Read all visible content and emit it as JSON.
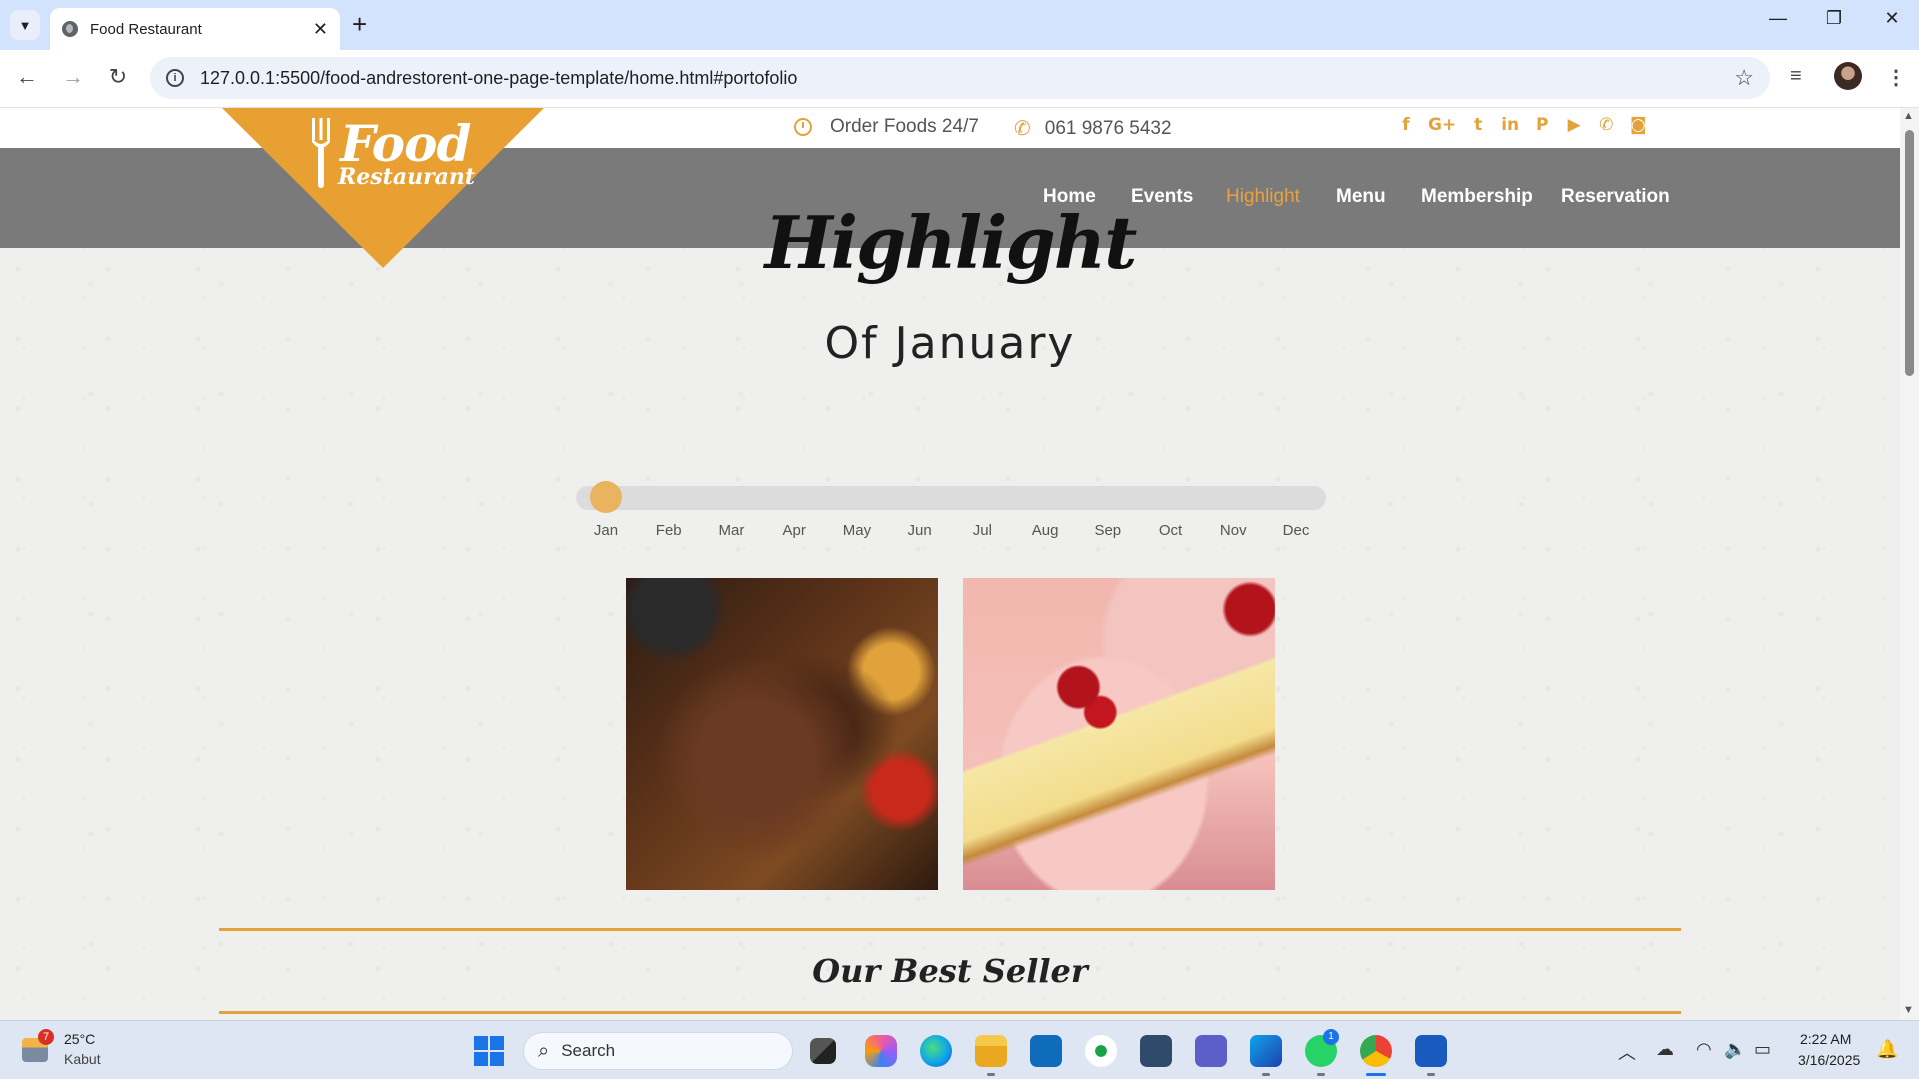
{
  "browser": {
    "tab_title": "Food Restaurant",
    "url": "127.0.0.1:5500/food-andrestorent-one-page-template/home.html#portofolio",
    "new_tab": "+",
    "tab_close": "✕"
  },
  "topbar": {
    "order_text": "Order Foods 24/7",
    "phone": "061 9876 5432",
    "social_icons": [
      "facebook-icon",
      "google-plus-icon",
      "twitter-icon",
      "linkedin-icon",
      "pinterest-icon",
      "youtube-icon",
      "phone-icon",
      "camera-icon"
    ],
    "social_glyphs": [
      "f",
      "G+",
      "t",
      "in",
      "P",
      "▶",
      "✆",
      "◙"
    ]
  },
  "logo": {
    "line1": "Food",
    "line2": "Restaurant"
  },
  "nav": {
    "items": [
      "Home",
      "Events",
      "Highlight",
      "Menu",
      "Membership",
      "Reservation"
    ],
    "active": "Highlight"
  },
  "highlight": {
    "title": "Highlight",
    "subtitle": "Of January",
    "months": [
      "Jan",
      "Feb",
      "Mar",
      "Apr",
      "May",
      "Jun",
      "Jul",
      "Aug",
      "Sep",
      "Oct",
      "Nov",
      "Dec"
    ],
    "selected_month_index": 0,
    "photos": [
      "grilled-steak-photo",
      "cheesecake-photo"
    ]
  },
  "best_seller": {
    "title": "Our Best Seller"
  },
  "taskbar": {
    "weather_temp": "25°C",
    "weather_condition": "Kabut",
    "weather_badge": "7",
    "search_placeholder": "Search",
    "whatsapp_badge": "1",
    "time": "2:22 AM",
    "date": "3/16/2025"
  },
  "colors": {
    "accent": "#e3a23a",
    "navbar": "#7a7a7a",
    "tab_strip": "#d3e3fd"
  }
}
